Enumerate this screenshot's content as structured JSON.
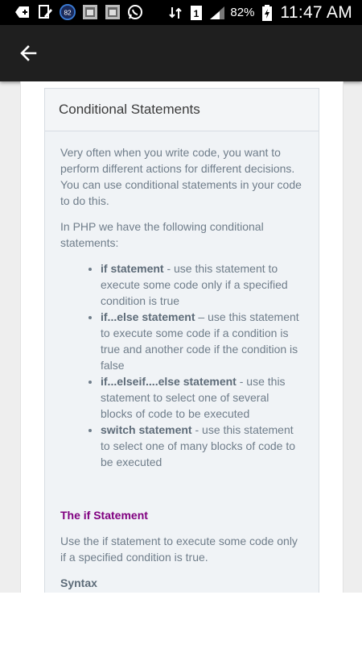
{
  "status_bar": {
    "notification_badge": "82",
    "sim_label": "1",
    "battery_percent": "82%",
    "time": "11:47 AM"
  },
  "card": {
    "title": "Conditional Statements",
    "intro": "Very often when you write code, you want to perform different actions for different decisions. You can use conditional statements in your code to do this.",
    "lead": "In PHP we have the following conditional statements:",
    "items": [
      {
        "term": "if statement",
        "desc": " - use this statement to execute some code only if a specified condition is true"
      },
      {
        "term": "if...else statement",
        "desc": " – use this statement to execute some code if a condition is true and another code if the condition is false"
      },
      {
        "term": "if...elseif....else statement",
        "desc": " - use this statement to select one of several blocks of code to be executed"
      },
      {
        "term": "switch statement",
        "desc": " - use this statement to select one of many blocks of code to be executed"
      }
    ],
    "section_title": "The if Statement",
    "section_text": "Use the if statement to execute some code only if a specified condition is true.",
    "syntax_label": "Syntax"
  },
  "colors": {
    "status_bar": "#000000",
    "app_bar": "#1f1f1f",
    "card_bg": "#f0f3f6",
    "body_text": "#6f7d8a",
    "section_title": "#800080"
  },
  "icons": {
    "back": "arrow-back-icon"
  }
}
